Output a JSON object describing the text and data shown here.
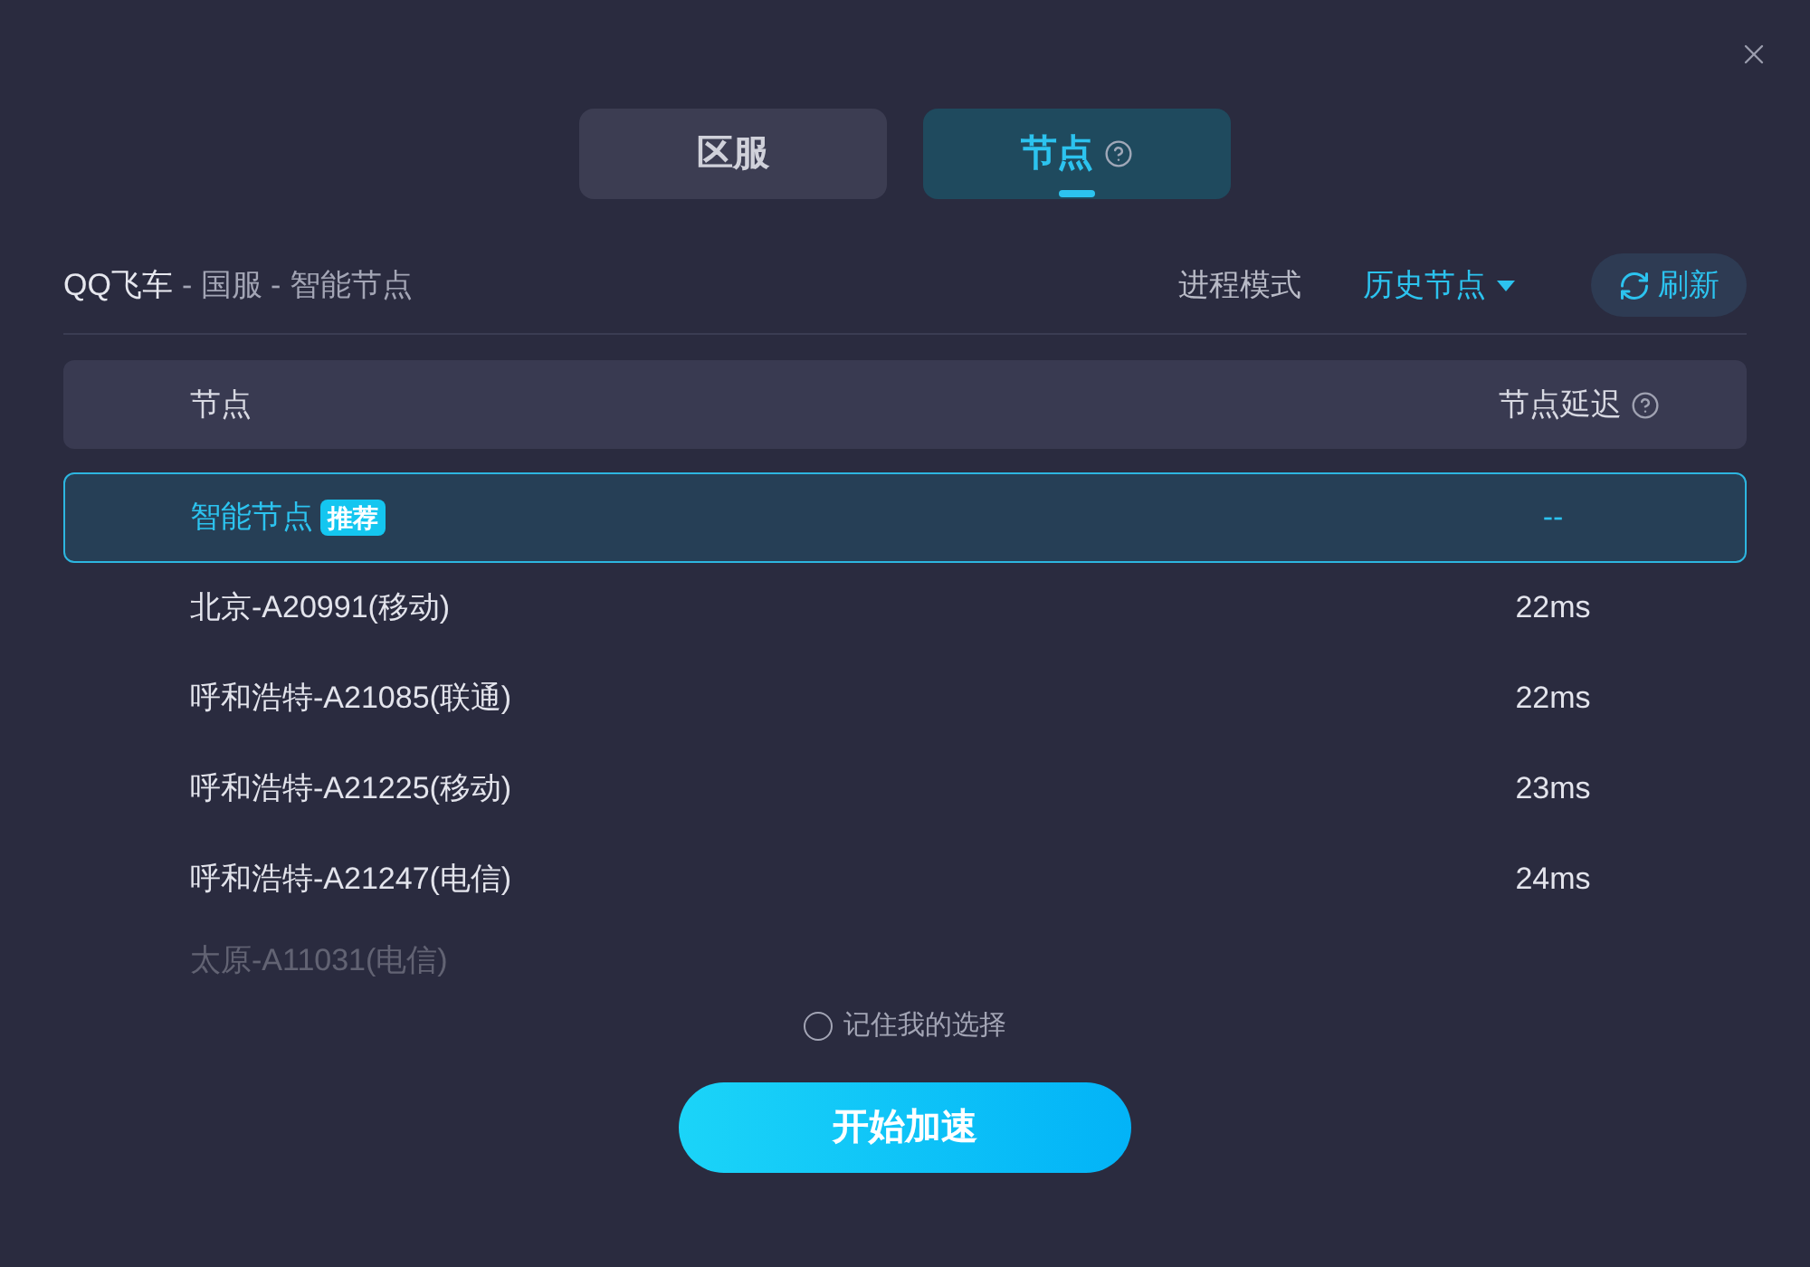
{
  "tabs": [
    {
      "label": "区服",
      "selected": false,
      "help": false
    },
    {
      "label": "节点",
      "selected": true,
      "help": true
    }
  ],
  "breadcrumb": {
    "game": "QQ飞车",
    "path": "- 国服 - 智能节点"
  },
  "toolbar": {
    "mode": "进程模式",
    "history": "历史节点",
    "refresh": "刷新"
  },
  "table": {
    "columns": [
      {
        "label": "节点",
        "help": false
      },
      {
        "label": "节点延迟",
        "help": true
      }
    ],
    "rows": [
      {
        "name": "智能节点",
        "badge": "推荐",
        "latency": "--",
        "selected": true,
        "faded": false
      },
      {
        "name": "北京-A20991(移动)",
        "latency": "22ms",
        "selected": false,
        "faded": false
      },
      {
        "name": "呼和浩特-A21085(联通)",
        "latency": "22ms",
        "selected": false,
        "faded": false
      },
      {
        "name": "呼和浩特-A21225(移动)",
        "latency": "23ms",
        "selected": false,
        "faded": false
      },
      {
        "name": "呼和浩特-A21247(电信)",
        "latency": "24ms",
        "selected": false,
        "faded": false
      },
      {
        "name": "太原-A11031(电信)",
        "selected": false,
        "faded": true
      }
    ]
  },
  "remember": {
    "label": "记住我的选择",
    "checked": false
  },
  "start_button": "开始加速"
}
